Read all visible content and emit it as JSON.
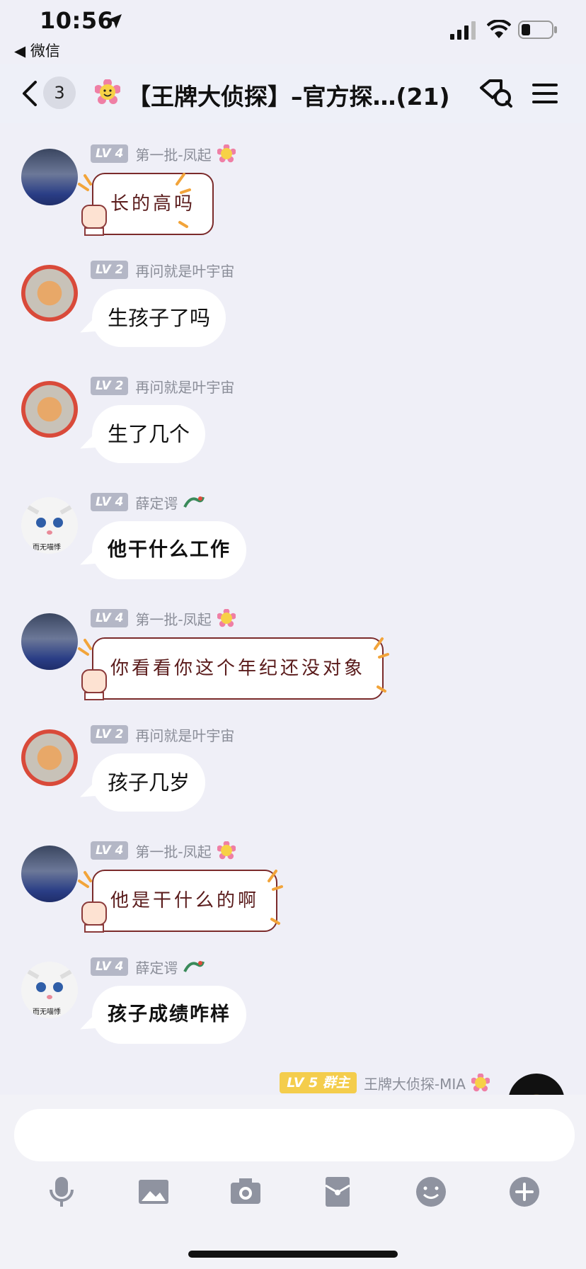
{
  "status_bar": {
    "time": "10:56",
    "back_app": "◀ 微信"
  },
  "header": {
    "unread_count": "3",
    "title": "【王牌大侦探】–官方探…(21)"
  },
  "messages": [
    {
      "level": "LV 4",
      "sender": "第一批-凤起",
      "text": "长的高吗",
      "style": "sticker"
    },
    {
      "level": "LV 2",
      "sender": "再问就是叶宇宙",
      "text": "生孩子了吗",
      "style": "bubble"
    },
    {
      "level": "LV 2",
      "sender": "再问就是叶宇宙",
      "text": "生了几个",
      "style": "bubble"
    },
    {
      "level": "LV 4",
      "sender": "薛定谔",
      "text": "他干什么工作",
      "style": "hand",
      "avatar_caption": "而无喵悸"
    },
    {
      "level": "LV 4",
      "sender": "第一批-凤起",
      "text": "你看看你这个年纪还没对象",
      "style": "sticker"
    },
    {
      "level": "LV 2",
      "sender": "再问就是叶宇宙",
      "text": "孩子几岁",
      "style": "bubble"
    },
    {
      "level": "LV 4",
      "sender": "第一批-凤起",
      "text": "他是干什么的啊",
      "style": "sticker"
    },
    {
      "level": "LV 4",
      "sender": "薛定谔",
      "text": "孩子成绩咋样",
      "style": "hand",
      "avatar_caption": "而无喵悸"
    }
  ],
  "my_message_meta": {
    "level": "LV 5",
    "role": "群主",
    "sender": "王牌大侦探-MIA"
  },
  "input": {
    "placeholder": ""
  },
  "toolbar": [
    "microphone-icon",
    "image-icon",
    "camera-icon",
    "redpacket-icon",
    "emoji-icon",
    "plus-icon"
  ],
  "colors": {
    "background": "#efeff7",
    "level_badge": "#b4b7c6",
    "owner_badge": "#f4cd4c",
    "sticker_border": "#7b2b2b"
  }
}
